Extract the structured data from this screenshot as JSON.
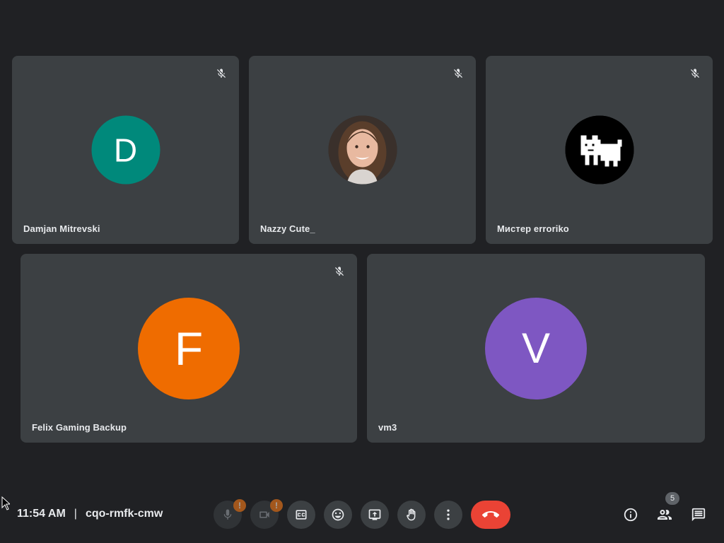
{
  "participants": [
    {
      "name": "Damjan Mitrevski",
      "initial": "D",
      "color": "#00897b",
      "muted": true,
      "avatar": "initial"
    },
    {
      "name": "Nazzy Cute_",
      "initial": "",
      "color": "#6b5a4e",
      "muted": true,
      "avatar": "photo"
    },
    {
      "name": "Мистер erroriko",
      "initial": "",
      "color": "#000000",
      "muted": true,
      "avatar": "pixel-dog"
    },
    {
      "name": "Felix Gaming Backup",
      "initial": "F",
      "color": "#ef6c00",
      "muted": true,
      "avatar": "initial"
    },
    {
      "name": "vm3",
      "initial": "V",
      "color": "#7e57c2",
      "muted": false,
      "avatar": "initial"
    }
  ],
  "footer": {
    "time": "11:54 AM",
    "separator": "|",
    "meeting_code": "cqo-rmfk-cmw",
    "mic_alert": "!",
    "cam_alert": "!",
    "participant_count": "5"
  },
  "icons": {
    "mic": "mic-off-icon",
    "camera": "camera-off-icon",
    "captions": "captions-icon",
    "emoji": "emoji-icon",
    "present": "present-screen-icon",
    "hand": "raise-hand-icon",
    "more": "more-options-icon",
    "end": "end-call-icon",
    "info": "info-icon",
    "people": "people-icon",
    "chat": "chat-icon"
  },
  "colors": {
    "background": "#202124",
    "tile": "#3c4043",
    "end_call": "#ea4335",
    "alert": "#fa7b17"
  }
}
